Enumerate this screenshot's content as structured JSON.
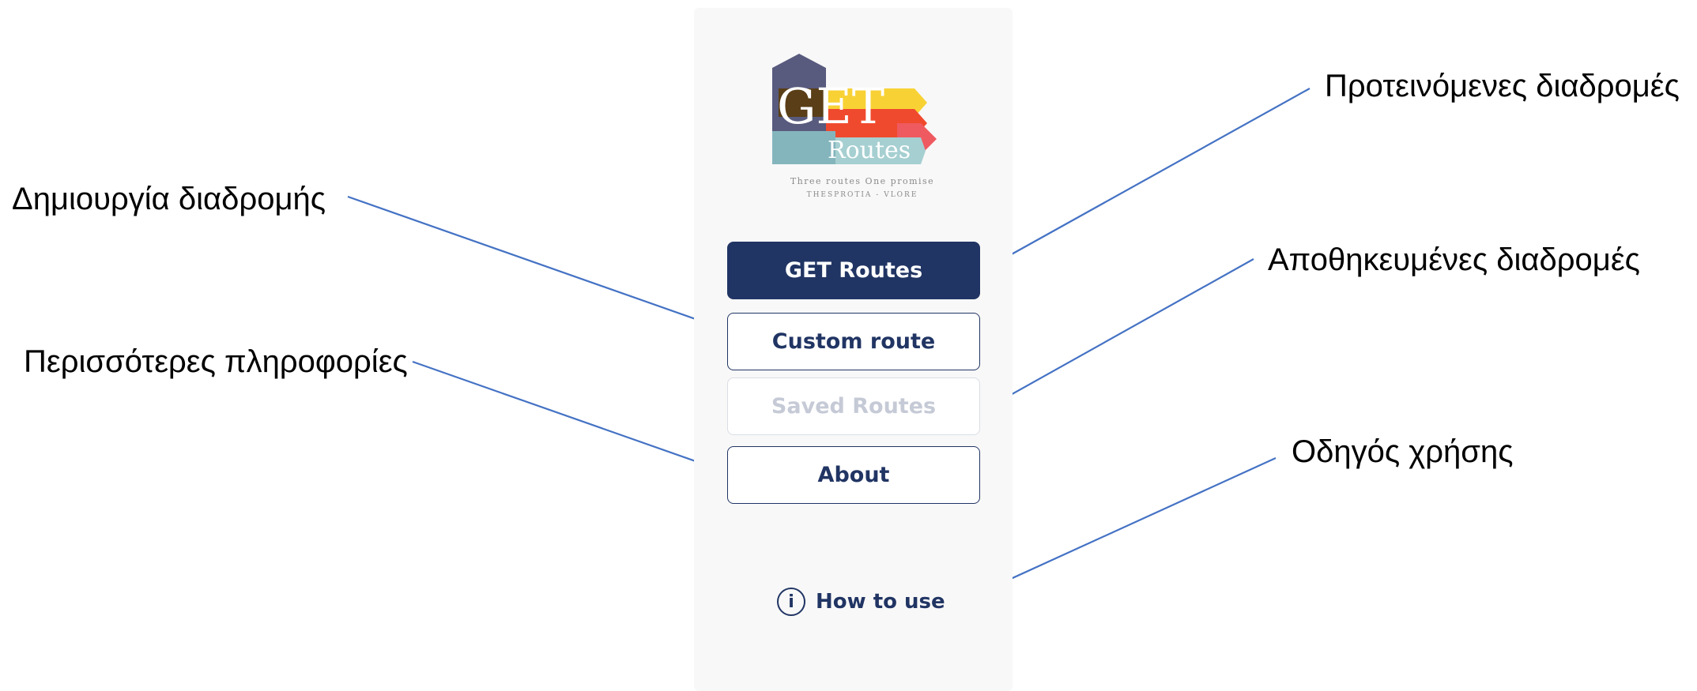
{
  "annotations": {
    "create_route": "Δημιουργία διαδρομής",
    "more_info": "Περισσότερες πληροφορίες",
    "suggested_routes": "Προτεινόμενες διαδρομές",
    "saved_routes": "Αποθηκευμένες διαδρομές",
    "user_guide": "Οδηγός χρήσης"
  },
  "logo": {
    "word_get": "GET",
    "word_routes": "Routes",
    "tagline": "Three routes One promise",
    "subtitle": "THESPROTIA - VLORE"
  },
  "menu": {
    "get_routes": "GET Routes",
    "custom_route": "Custom route",
    "saved_routes": "Saved Routes",
    "about": "About"
  },
  "footer": {
    "how_to_use": "How to use",
    "info_icon_glyph": "i"
  },
  "colors": {
    "primary": "#213564",
    "arrow": "#4472C4",
    "disabled_text": "#c5cad6"
  }
}
